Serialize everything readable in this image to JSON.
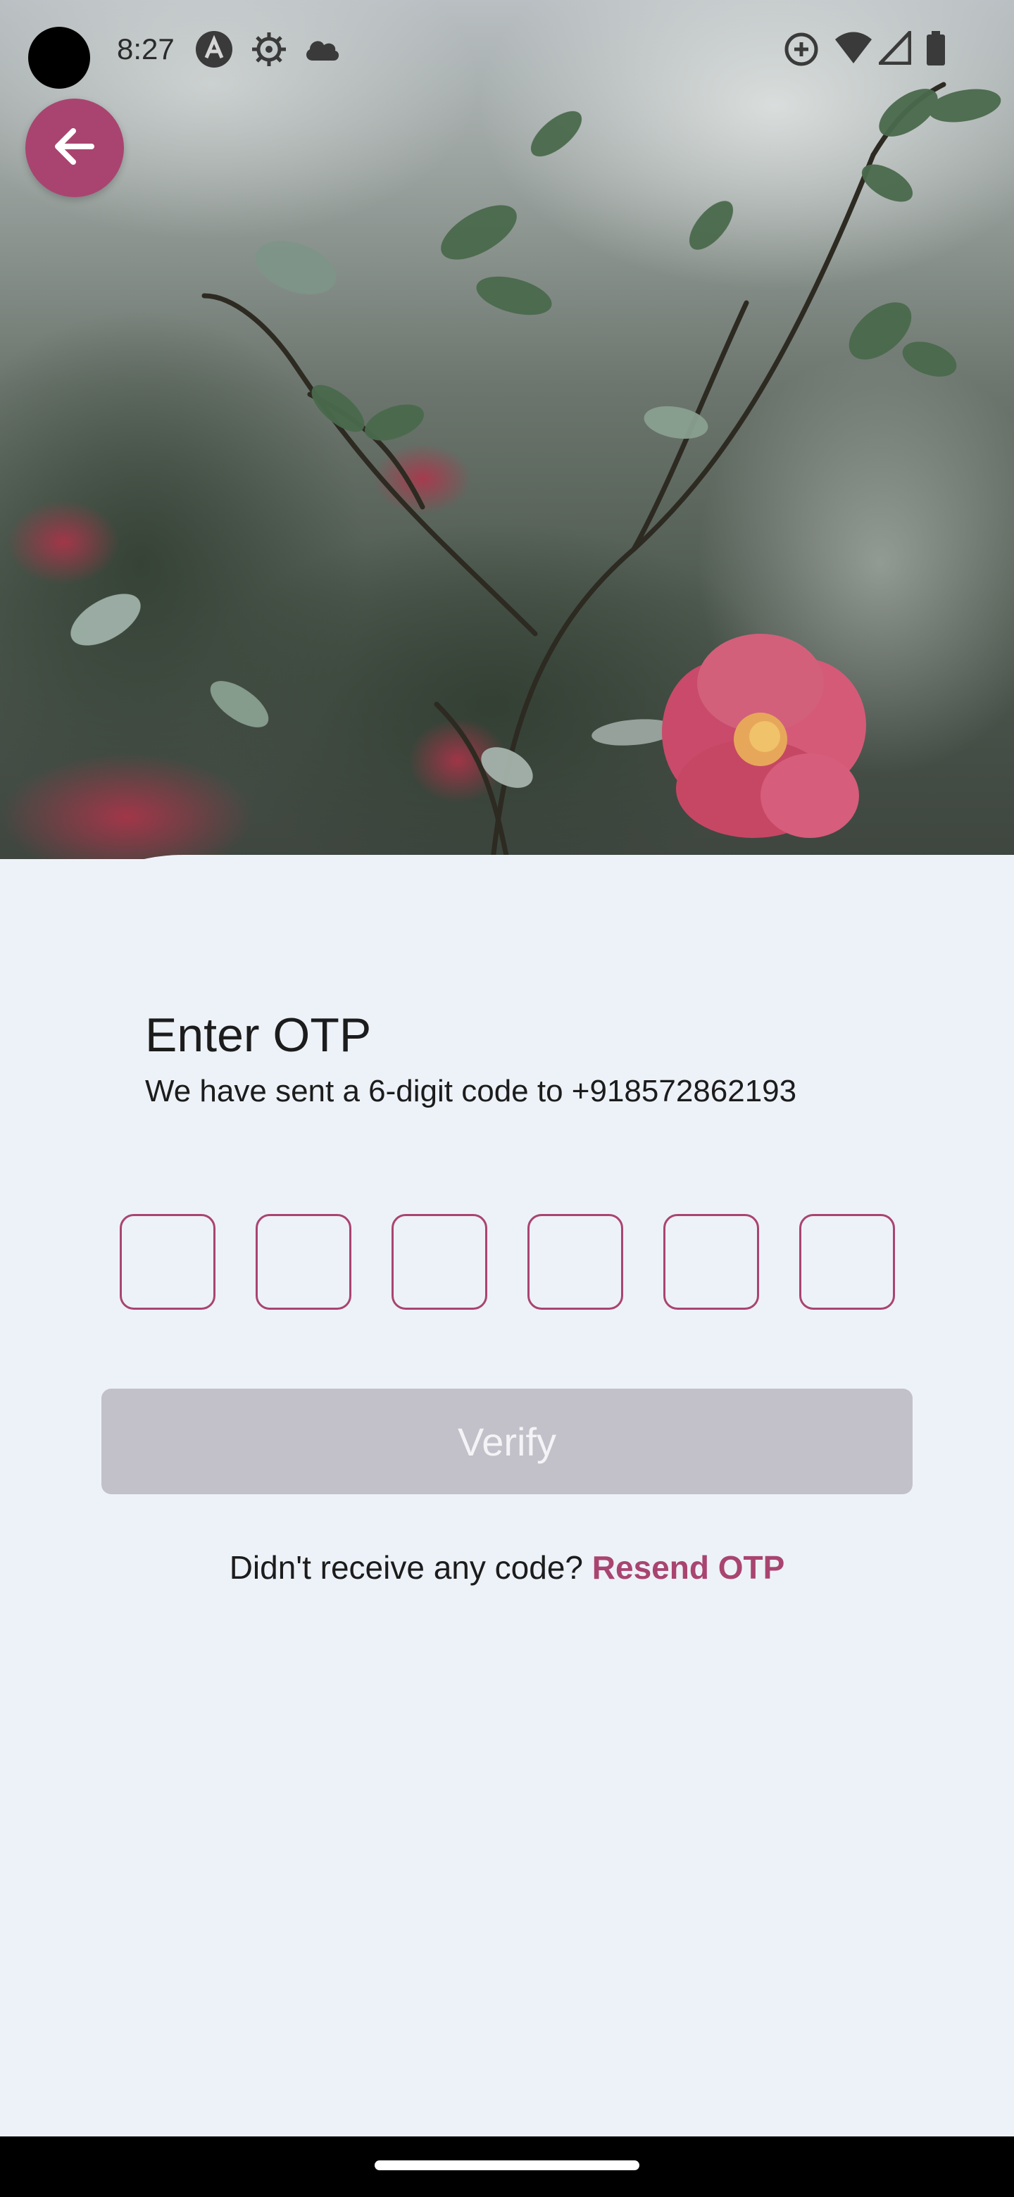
{
  "status_bar": {
    "time": "8:27",
    "left_icons": [
      "a-circle-icon",
      "settings-gear-icon",
      "cloud-icon"
    ],
    "right_icons": [
      "data-saver-icon",
      "wifi-icon",
      "signal-icon",
      "battery-icon"
    ]
  },
  "hero": {
    "image": "camellia-flower-photo"
  },
  "back_button": {
    "icon": "arrow-left-icon"
  },
  "otp_screen": {
    "title": "Enter OTP",
    "subtitle": "We have sent a 6-digit code to +918572862193",
    "digits": [
      "",
      "",
      "",
      "",
      "",
      ""
    ],
    "verify_label": "Verify",
    "resend_prompt": "Didn't receive any code?",
    "resend_link": "Resend OTP"
  },
  "colors": {
    "accent": "#a94470",
    "background": "#edf2f8",
    "button_disabled": "#c2c0c9"
  }
}
